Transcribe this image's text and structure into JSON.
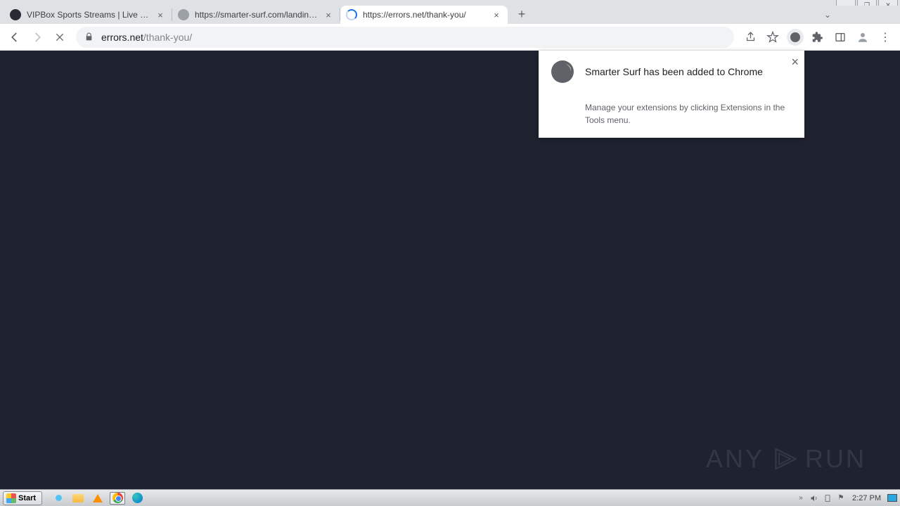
{
  "window_controls": {
    "min": "—",
    "max": "❐",
    "close": "✕"
  },
  "tabs": [
    {
      "title": "VIPBox Sports Streams | Live VIPBo"
    },
    {
      "title": "https://smarter-surf.com/landing/?a"
    },
    {
      "title": "https://errors.net/thank-you/"
    }
  ],
  "tabstrip_chevron": "⌄",
  "newtab": "+",
  "nav": {
    "back": "←",
    "forward": "→",
    "stop": "✕"
  },
  "url": {
    "host": "errors.net",
    "path": "/thank-you/"
  },
  "toolbar_icons": {
    "share": "share-icon",
    "bookmark": "☆",
    "extensions": "puzzle-icon",
    "sidepanel": "sidepanel-icon",
    "profile": "profile-icon",
    "menu": "⋮"
  },
  "notification": {
    "title": "Smarter Surf has been added to Chrome",
    "body": "Manage your extensions by clicking Extensions in the Tools menu.",
    "close": "×"
  },
  "watermark": {
    "left": "ANY",
    "right": "RUN"
  },
  "taskbar": {
    "start": "Start",
    "clock": "2:27 PM",
    "tray_chev": "»",
    "tray_flag": "⚑"
  }
}
